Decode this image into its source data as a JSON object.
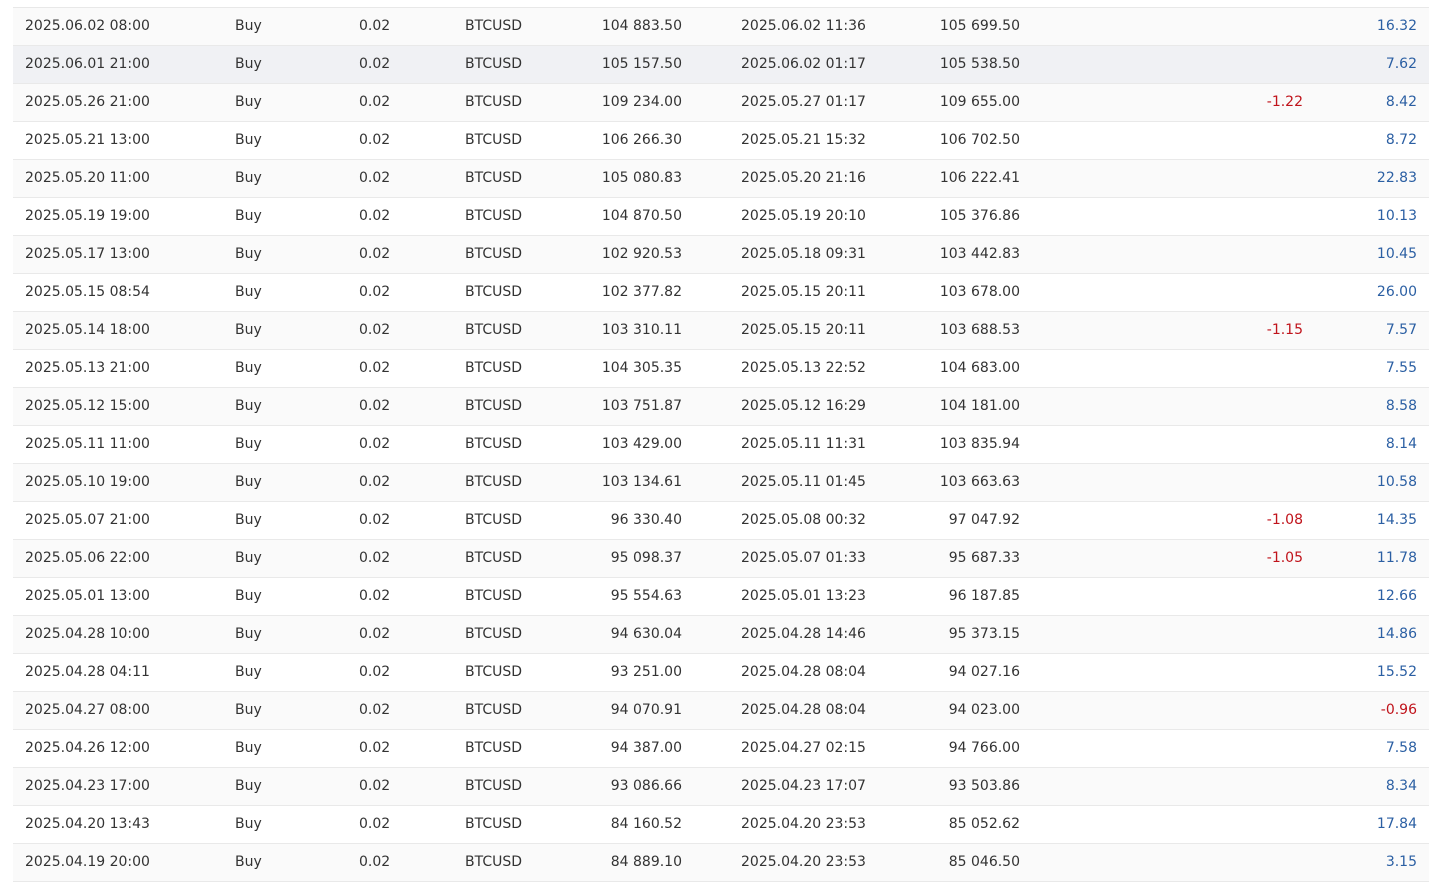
{
  "colors": {
    "positive_profit": "#2b5fa3",
    "negative_value": "#c0131b",
    "text": "#333333",
    "row_highlight": "#f0f1f4"
  },
  "trades": [
    {
      "open_time": "2025.06.02 08:00",
      "type": "Buy",
      "volume": "0.02",
      "symbol": "BTCUSD",
      "open_price": "104 883.50",
      "close_time": "2025.06.02 11:36",
      "close_price": "105 699.50",
      "commission": "",
      "profit": "16.32"
    },
    {
      "open_time": "2025.06.01 21:00",
      "type": "Buy",
      "volume": "0.02",
      "symbol": "BTCUSD",
      "open_price": "105 157.50",
      "close_time": "2025.06.02 01:17",
      "close_price": "105 538.50",
      "commission": "",
      "profit": "7.62"
    },
    {
      "open_time": "2025.05.26 21:00",
      "type": "Buy",
      "volume": "0.02",
      "symbol": "BTCUSD",
      "open_price": "109 234.00",
      "close_time": "2025.05.27 01:17",
      "close_price": "109 655.00",
      "commission": "-1.22",
      "profit": "8.42"
    },
    {
      "open_time": "2025.05.21 13:00",
      "type": "Buy",
      "volume": "0.02",
      "symbol": "BTCUSD",
      "open_price": "106 266.30",
      "close_time": "2025.05.21 15:32",
      "close_price": "106 702.50",
      "commission": "",
      "profit": "8.72"
    },
    {
      "open_time": "2025.05.20 11:00",
      "type": "Buy",
      "volume": "0.02",
      "symbol": "BTCUSD",
      "open_price": "105 080.83",
      "close_time": "2025.05.20 21:16",
      "close_price": "106 222.41",
      "commission": "",
      "profit": "22.83"
    },
    {
      "open_time": "2025.05.19 19:00",
      "type": "Buy",
      "volume": "0.02",
      "symbol": "BTCUSD",
      "open_price": "104 870.50",
      "close_time": "2025.05.19 20:10",
      "close_price": "105 376.86",
      "commission": "",
      "profit": "10.13"
    },
    {
      "open_time": "2025.05.17 13:00",
      "type": "Buy",
      "volume": "0.02",
      "symbol": "BTCUSD",
      "open_price": "102 920.53",
      "close_time": "2025.05.18 09:31",
      "close_price": "103 442.83",
      "commission": "",
      "profit": "10.45"
    },
    {
      "open_time": "2025.05.15 08:54",
      "type": "Buy",
      "volume": "0.02",
      "symbol": "BTCUSD",
      "open_price": "102 377.82",
      "close_time": "2025.05.15 20:11",
      "close_price": "103 678.00",
      "commission": "",
      "profit": "26.00"
    },
    {
      "open_time": "2025.05.14 18:00",
      "type": "Buy",
      "volume": "0.02",
      "symbol": "BTCUSD",
      "open_price": "103 310.11",
      "close_time": "2025.05.15 20:11",
      "close_price": "103 688.53",
      "commission": "-1.15",
      "profit": "7.57"
    },
    {
      "open_time": "2025.05.13 21:00",
      "type": "Buy",
      "volume": "0.02",
      "symbol": "BTCUSD",
      "open_price": "104 305.35",
      "close_time": "2025.05.13 22:52",
      "close_price": "104 683.00",
      "commission": "",
      "profit": "7.55"
    },
    {
      "open_time": "2025.05.12 15:00",
      "type": "Buy",
      "volume": "0.02",
      "symbol": "BTCUSD",
      "open_price": "103 751.87",
      "close_time": "2025.05.12 16:29",
      "close_price": "104 181.00",
      "commission": "",
      "profit": "8.58"
    },
    {
      "open_time": "2025.05.11 11:00",
      "type": "Buy",
      "volume": "0.02",
      "symbol": "BTCUSD",
      "open_price": "103 429.00",
      "close_time": "2025.05.11 11:31",
      "close_price": "103 835.94",
      "commission": "",
      "profit": "8.14"
    },
    {
      "open_time": "2025.05.10 19:00",
      "type": "Buy",
      "volume": "0.02",
      "symbol": "BTCUSD",
      "open_price": "103 134.61",
      "close_time": "2025.05.11 01:45",
      "close_price": "103 663.63",
      "commission": "",
      "profit": "10.58"
    },
    {
      "open_time": "2025.05.07 21:00",
      "type": "Buy",
      "volume": "0.02",
      "symbol": "BTCUSD",
      "open_price": "96 330.40",
      "close_time": "2025.05.08 00:32",
      "close_price": "97 047.92",
      "commission": "-1.08",
      "profit": "14.35"
    },
    {
      "open_time": "2025.05.06 22:00",
      "type": "Buy",
      "volume": "0.02",
      "symbol": "BTCUSD",
      "open_price": "95 098.37",
      "close_time": "2025.05.07 01:33",
      "close_price": "95 687.33",
      "commission": "-1.05",
      "profit": "11.78"
    },
    {
      "open_time": "2025.05.01 13:00",
      "type": "Buy",
      "volume": "0.02",
      "symbol": "BTCUSD",
      "open_price": "95 554.63",
      "close_time": "2025.05.01 13:23",
      "close_price": "96 187.85",
      "commission": "",
      "profit": "12.66"
    },
    {
      "open_time": "2025.04.28 10:00",
      "type": "Buy",
      "volume": "0.02",
      "symbol": "BTCUSD",
      "open_price": "94 630.04",
      "close_time": "2025.04.28 14:46",
      "close_price": "95 373.15",
      "commission": "",
      "profit": "14.86"
    },
    {
      "open_time": "2025.04.28 04:11",
      "type": "Buy",
      "volume": "0.02",
      "symbol": "BTCUSD",
      "open_price": "93 251.00",
      "close_time": "2025.04.28 08:04",
      "close_price": "94 027.16",
      "commission": "",
      "profit": "15.52"
    },
    {
      "open_time": "2025.04.27 08:00",
      "type": "Buy",
      "volume": "0.02",
      "symbol": "BTCUSD",
      "open_price": "94 070.91",
      "close_time": "2025.04.28 08:04",
      "close_price": "94 023.00",
      "commission": "",
      "profit": "-0.96"
    },
    {
      "open_time": "2025.04.26 12:00",
      "type": "Buy",
      "volume": "0.02",
      "symbol": "BTCUSD",
      "open_price": "94 387.00",
      "close_time": "2025.04.27 02:15",
      "close_price": "94 766.00",
      "commission": "",
      "profit": "7.58"
    },
    {
      "open_time": "2025.04.23 17:00",
      "type": "Buy",
      "volume": "0.02",
      "symbol": "BTCUSD",
      "open_price": "93 086.66",
      "close_time": "2025.04.23 17:07",
      "close_price": "93 503.86",
      "commission": "",
      "profit": "8.34"
    },
    {
      "open_time": "2025.04.20 13:43",
      "type": "Buy",
      "volume": "0.02",
      "symbol": "BTCUSD",
      "open_price": "84 160.52",
      "close_time": "2025.04.20 23:53",
      "close_price": "85 052.62",
      "commission": "",
      "profit": "17.84"
    },
    {
      "open_time": "2025.04.19 20:00",
      "type": "Buy",
      "volume": "0.02",
      "symbol": "BTCUSD",
      "open_price": "84 889.10",
      "close_time": "2025.04.20 23:53",
      "close_price": "85 046.50",
      "commission": "",
      "profit": "3.15"
    }
  ]
}
